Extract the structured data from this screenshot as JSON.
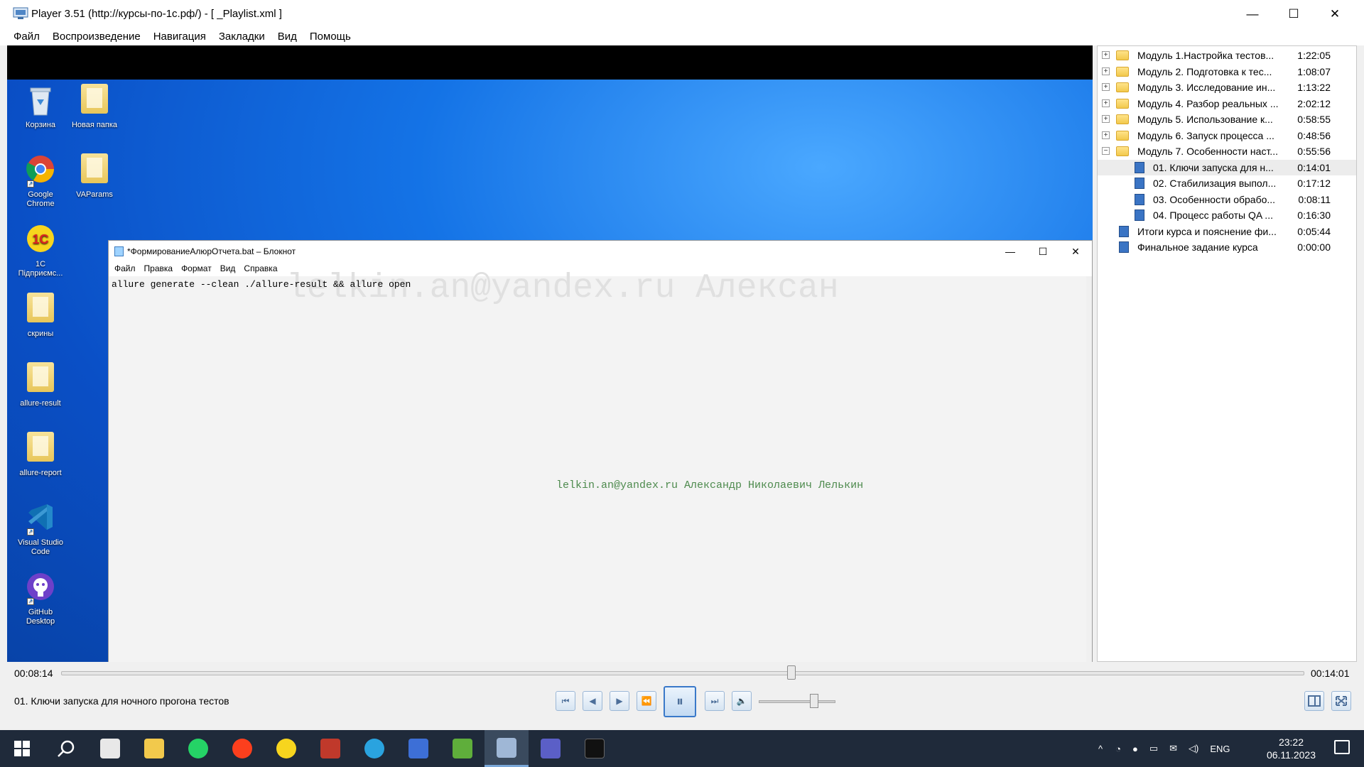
{
  "window": {
    "title": "Player 3.51 (http://курсы-по-1с.рф/) - [ _Playlist.xml ]",
    "minimize": "—",
    "maximize": "☐",
    "close": "✕"
  },
  "menu": [
    "Файл",
    "Воспроизведение",
    "Навигация",
    "Закладки",
    "Вид",
    "Помощь"
  ],
  "desktop_icons": [
    {
      "label": "Корзина"
    },
    {
      "label": "Новая папка"
    },
    {
      "label": "Google Chrome"
    },
    {
      "label": "VAParams"
    },
    {
      "label": "1С Підприємс..."
    },
    {
      "label": "скрины"
    },
    {
      "label": "allure-result"
    },
    {
      "label": "allure-report"
    },
    {
      "label": "Visual Studio Code"
    },
    {
      "label": "GitHub Desktop"
    }
  ],
  "notepad": {
    "title": "*ФормированиеАлюрОтчета.bat – Блокнот",
    "menu": [
      "Файл",
      "Правка",
      "Формат",
      "Вид",
      "Справка"
    ],
    "content": "allure generate --clean ./allure-result && allure open",
    "watermark_big": "lelkin.an@yandex.ru Алексан",
    "watermark": "lelkin.an@yandex.ru Александр Николаевич Лелькин",
    "minimize": "—",
    "maximize": "☐",
    "close": "✕"
  },
  "playlist": [
    {
      "name": "Модуль 1.Настройка тестов...",
      "time": "1:22:05",
      "type": "folder",
      "expander": "+"
    },
    {
      "name": "Модуль 2. Подготовка к тес...",
      "time": "1:08:07",
      "type": "folder",
      "expander": "+"
    },
    {
      "name": "Модуль 3. Исследование ин...",
      "time": "1:13:22",
      "type": "folder",
      "expander": "+"
    },
    {
      "name": "Модуль 4. Разбор реальных ...",
      "time": "2:02:12",
      "type": "folder",
      "expander": "+"
    },
    {
      "name": "Модуль 5. Использование к...",
      "time": "0:58:55",
      "type": "folder",
      "expander": "+"
    },
    {
      "name": "Модуль 6. Запуск процесса ...",
      "time": "0:48:56",
      "type": "folder",
      "expander": "+"
    },
    {
      "name": "Модуль 7. Особенности наст...",
      "time": "0:55:56",
      "type": "folder",
      "expander": "−"
    },
    {
      "name": "01. Ключи запуска для н...",
      "time": "0:14:01",
      "type": "file",
      "child": true,
      "selected": true
    },
    {
      "name": "02. Стабилизация выпол...",
      "time": "0:17:12",
      "type": "file",
      "child": true
    },
    {
      "name": "03. Особенности обрабо...",
      "time": "0:08:11",
      "type": "file",
      "child": true
    },
    {
      "name": "04. Процесс работы QA ...",
      "time": "0:16:30",
      "type": "file",
      "child": true
    },
    {
      "name": "Итоги курса и пояснение фи...",
      "time": "0:05:44",
      "type": "file"
    },
    {
      "name": "Финальное задание курса",
      "time": "0:00:00",
      "type": "file"
    }
  ],
  "player": {
    "current_time": "00:08:14",
    "total_time": "00:14:01",
    "progress": 0.5875,
    "now_playing": "01. Ключи запуска для ночного прогона тестов",
    "volume": 0.72
  },
  "controls": [
    {
      "name": "prev-track-button",
      "glyph": "⏮"
    },
    {
      "name": "step-back-button",
      "glyph": "◀"
    },
    {
      "name": "step-forward-button",
      "glyph": "▶"
    },
    {
      "name": "rewind-button",
      "glyph": "⏪"
    },
    {
      "name": "pause-button",
      "glyph": "⏸"
    },
    {
      "name": "next-track-button",
      "glyph": "⏭"
    },
    {
      "name": "mute-button",
      "glyph": "🔈"
    }
  ],
  "taskbar": {
    "tray_lang": "ENG",
    "time": "23:22",
    "date": "06.11.2023"
  },
  "colors": {
    "accent": "#3a79c9",
    "taskbar": "#1f2a3a",
    "watermark": "#4d8a4d"
  }
}
